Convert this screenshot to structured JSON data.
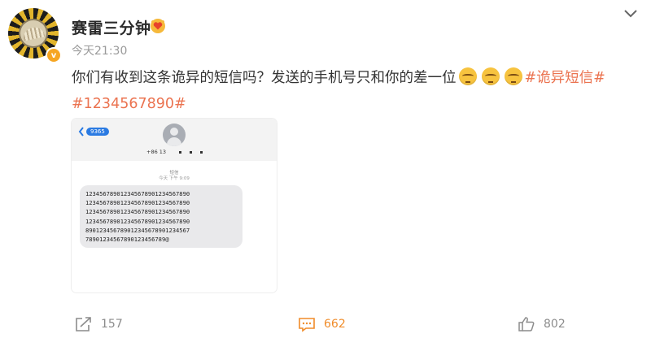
{
  "post": {
    "username": "赛雷三分钟",
    "timestamp": "今天21:30",
    "text_main": "你们有收到这条诡异的短信吗？发送的手机号只和你的差一位",
    "hashtag_1": "#诡异短信#",
    "hashtag_2": "#1234567890#"
  },
  "screenshot": {
    "back_badge": "9365",
    "phone_number": "+86 13",
    "meta_title": "短信",
    "meta_time": "今天 下午 9:09",
    "message_lines": [
      "123456789012345678901234567890",
      "123456789012345678901234567890",
      "123456789012345678901234567890",
      "123456789012345678901234567890",
      "890123456789012345678901234567",
      "78901234567890123456789@"
    ]
  },
  "actions": {
    "repost_count": "157",
    "comment_count": "662",
    "like_count": "802"
  },
  "colors": {
    "hashtag": "#eb7350",
    "comment_accent": "#f08c2a",
    "imessage_blue": "#2a7ae2"
  }
}
